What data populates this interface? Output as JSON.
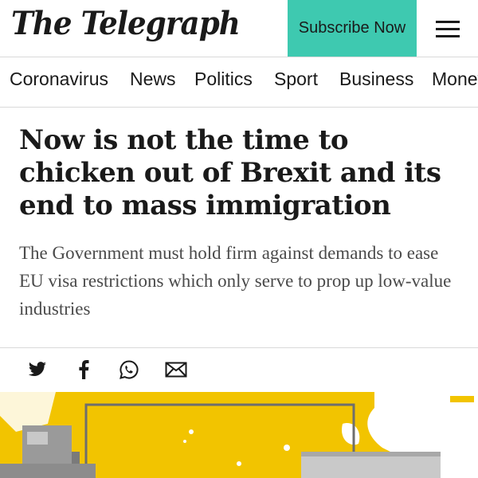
{
  "header": {
    "logo": "The Telegraph",
    "subscribe_label": "Subscribe Now",
    "accent_color": "#3ec9b0"
  },
  "nav": {
    "items": [
      {
        "label": "Coronavirus"
      },
      {
        "label": "News"
      },
      {
        "label": "Politics"
      },
      {
        "label": "Sport"
      },
      {
        "label": "Business"
      },
      {
        "label": "Money"
      }
    ]
  },
  "article": {
    "headline": "Now is not the time to chicken out of Brexit and its end to mass immigration",
    "standfirst": "The Government must hold firm against demands to ease EU visa restrictions which only serve to prop up low-value industries"
  },
  "share": {
    "icons": [
      "twitter-icon",
      "facebook-icon",
      "whatsapp-icon",
      "email-icon"
    ]
  },
  "hero": {
    "colors": {
      "yellow": "#f2c400",
      "white": "#ffffff",
      "grey": "#8c8c8c"
    }
  }
}
